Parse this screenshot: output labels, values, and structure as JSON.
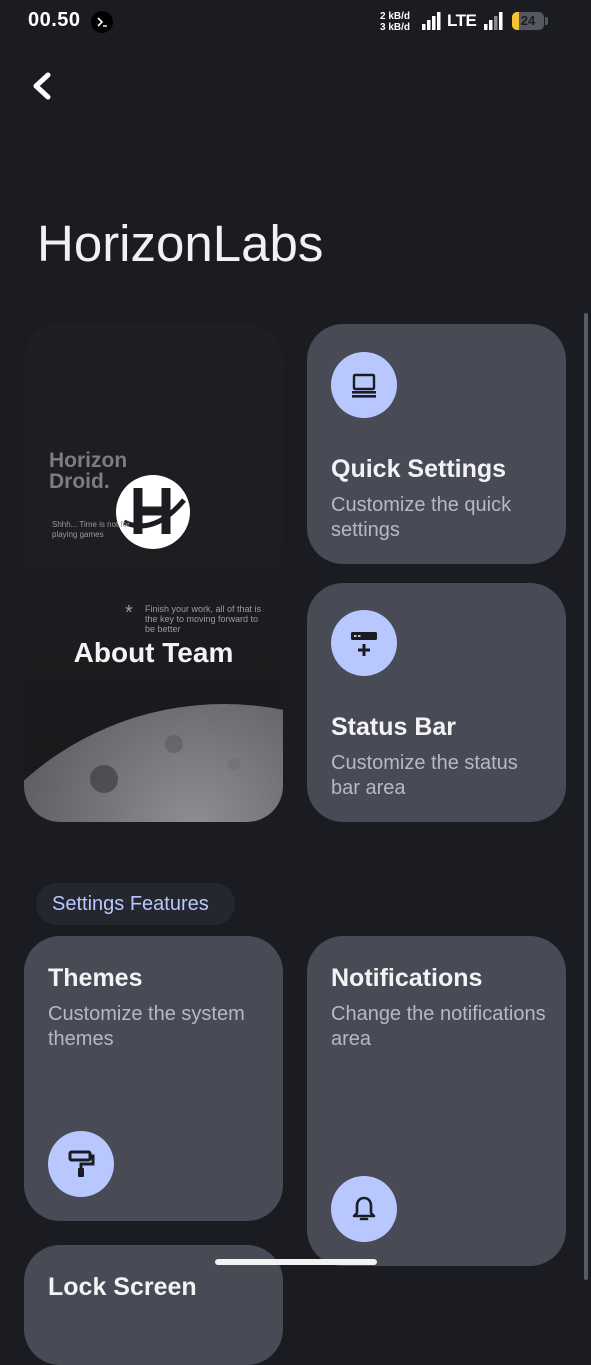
{
  "status_bar": {
    "time": "00.50",
    "rate_up": "2 kB/d",
    "rate_down": "3 kB/d",
    "network": "LTE",
    "battery": "24"
  },
  "header": {
    "title": "HorizonLabs"
  },
  "about_card": {
    "label": "About Team",
    "logo_text_line1": "Horizon",
    "logo_text_line2": "Droid.",
    "tagline": "Shhh... Time is not for playing games",
    "quote": "Finish your work, all of that is the key to moving forward to be better"
  },
  "quick_settings": {
    "title": "Quick Settings",
    "desc": "Customize the quick settings",
    "icon": "laptop-icon"
  },
  "status_bar_card": {
    "title": "Status Bar",
    "desc": "Customize the status bar area",
    "icon": "statusbar-add-icon"
  },
  "section": {
    "label": "Settings Features"
  },
  "themes": {
    "title": "Themes",
    "desc": "Customize the system themes",
    "icon": "paint-roller-icon"
  },
  "notifications": {
    "title": "Notifications",
    "desc": "Change the notifications area",
    "icon": "bell-icon"
  },
  "partial_card": {
    "title": "Lock Screen"
  },
  "colors": {
    "accent": "#b8c8ff",
    "card": "#484b56",
    "background": "#1b1c21"
  }
}
